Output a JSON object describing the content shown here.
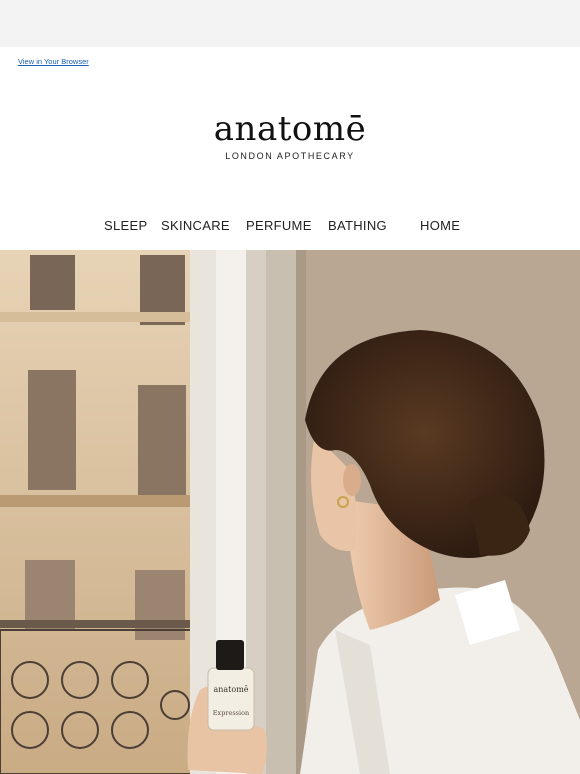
{
  "header": {
    "view_in_browser": "View in Your Browser"
  },
  "brand": {
    "name": "anatomē",
    "tagline": "LONDON APOTHECARY"
  },
  "nav": {
    "items": [
      "SLEEP",
      "SKINCARE",
      "PERFUME",
      "BATHING",
      "HOME"
    ]
  },
  "hero": {
    "bottle_brand": "anatomē",
    "bottle_label": "Expression"
  },
  "colors": {
    "background": "#f3f3f3",
    "card": "#ffffff",
    "link": "#1a5fb4",
    "text": "#222222"
  }
}
